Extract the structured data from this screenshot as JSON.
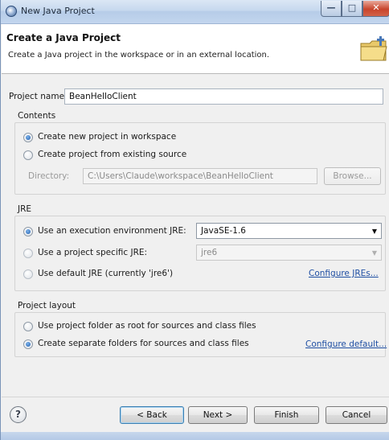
{
  "window": {
    "title": "New Java Project"
  },
  "header": {
    "title": "Create a Java Project",
    "description": "Create a Java project in the workspace or in an external location."
  },
  "project_name": {
    "label": "Project name:",
    "value": "BeanHelloClient"
  },
  "contents": {
    "title": "Contents",
    "option_new": "Create new project in workspace",
    "option_existing": "Create project from existing source",
    "directory_label": "Directory:",
    "directory_value": "C:\\Users\\Claude\\workspace\\BeanHelloClient",
    "browse": "Browse...",
    "selected": "option_new"
  },
  "jre": {
    "title": "JRE",
    "option_env": "Use an execution environment JRE:",
    "env_value": "JavaSE-1.6",
    "option_specific": "Use a project specific JRE:",
    "specific_value": "jre6",
    "option_default": "Use default JRE (currently 'jre6')",
    "configure_link": "Configure JREs...",
    "selected": "option_env"
  },
  "layout": {
    "title": "Project layout",
    "option_root": "Use project folder as root for sources and class files",
    "option_separate": "Create separate folders for sources and class files",
    "configure_link": "Configure default...",
    "selected": "option_separate"
  },
  "footer": {
    "back": "< Back",
    "next": "Next >",
    "finish": "Finish",
    "cancel": "Cancel",
    "help_icon": "help-icon"
  }
}
